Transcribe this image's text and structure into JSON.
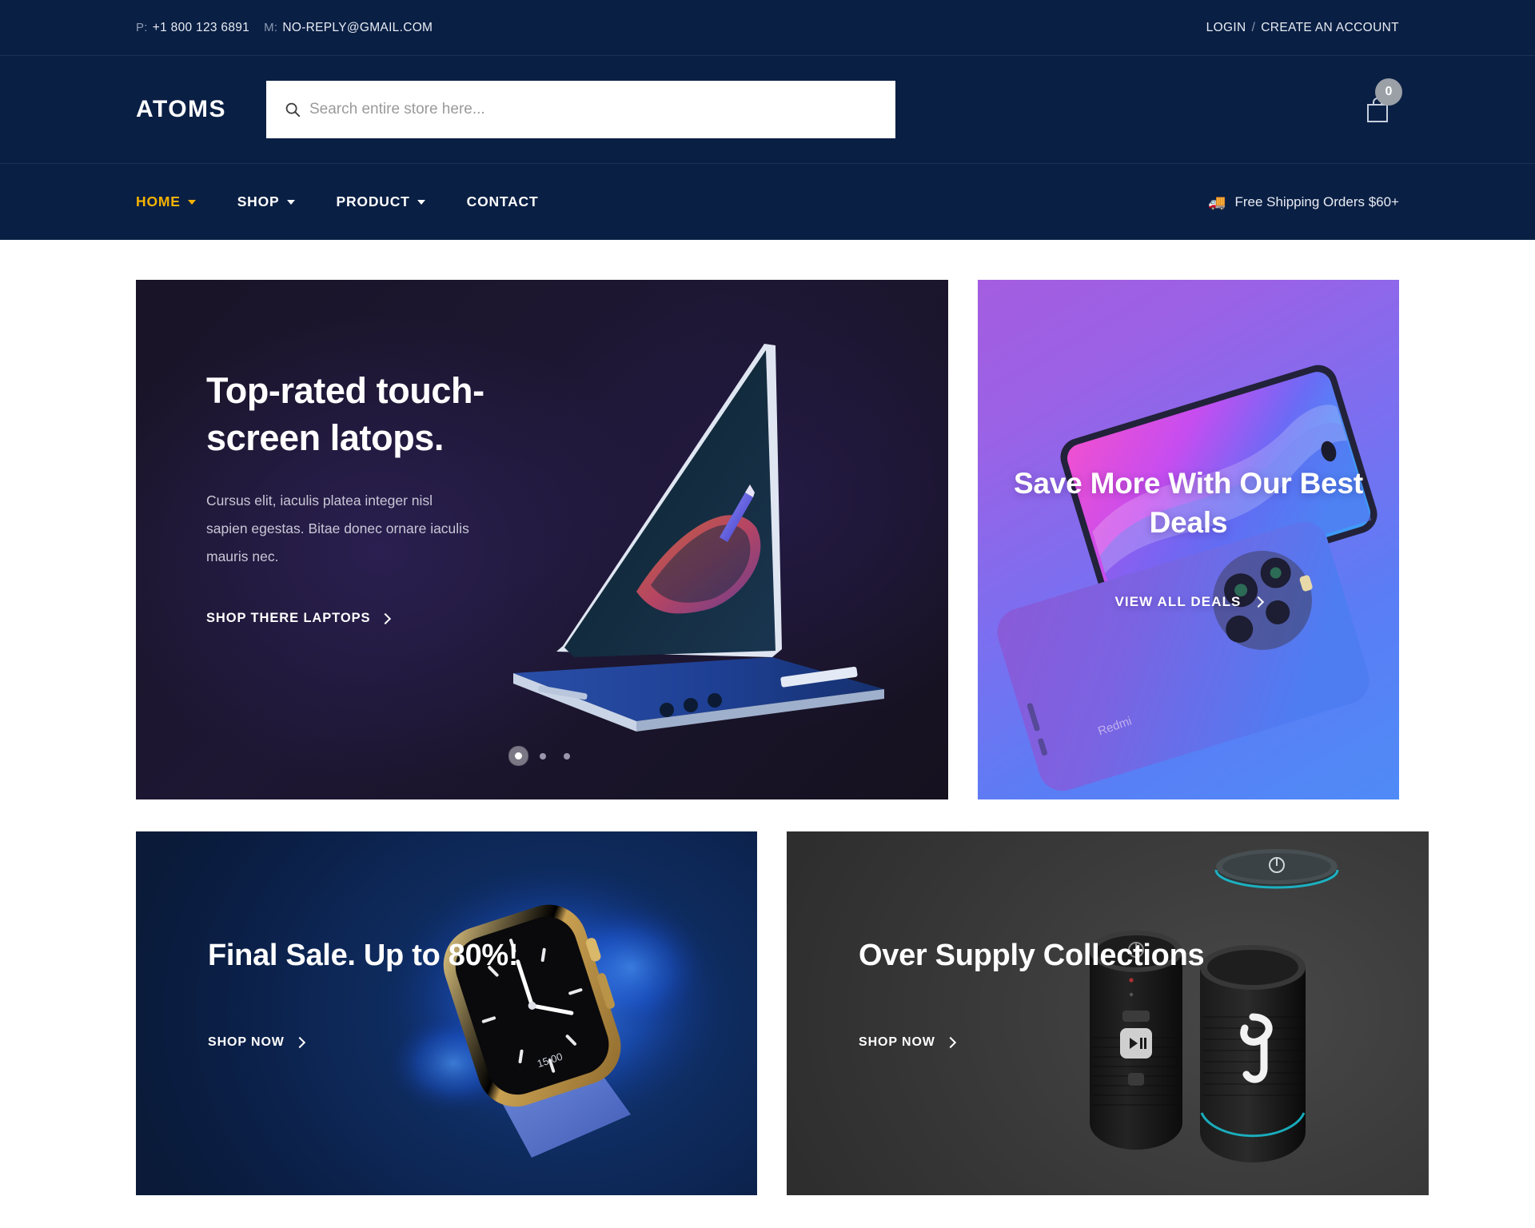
{
  "topbar": {
    "phone_label": "P:",
    "phone_value": "+1 800 123 6891",
    "mail_label": "M:",
    "mail_value": "NO-REPLY@GMAIL.COM",
    "login_label": "LOGIN",
    "separator": "/",
    "create_account_label": "CREATE AN ACCOUNT"
  },
  "masthead": {
    "logo": "ATOMS",
    "search_placeholder": "Search entire store here...",
    "search_value": "",
    "search_icon": "search-icon",
    "cart_icon": "shopping-bag-icon",
    "cart_count": "0"
  },
  "nav": {
    "items": [
      {
        "label": "HOME",
        "has_caret": true,
        "active": true
      },
      {
        "label": "SHOP",
        "has_caret": true,
        "active": false
      },
      {
        "label": "PRODUCT",
        "has_caret": true,
        "active": false
      },
      {
        "label": "CONTACT",
        "has_caret": false,
        "active": false
      }
    ],
    "shipping_icon": "delivery-truck-icon",
    "shipping_text": "Free Shipping Orders $60+"
  },
  "hero": {
    "title": "Top-rated touch-screen latops.",
    "body": "Cursus elit, iaculis platea integer nisl sapien egestas. Bitae donec ornare iaculis mauris nec.",
    "cta_label": "SHOP THERE LAPTOPS",
    "slides_total": 3,
    "active_slide": 1
  },
  "promo": {
    "title": "Save More With Our Best Deals",
    "cta_label": "VIEW ALL DEALS"
  },
  "cards": {
    "watch": {
      "title": "Final Sale. Up to 80%!",
      "cta_label": "SHOP NOW"
    },
    "speaker": {
      "title": "Over Supply Collections",
      "cta_label": "SHOP NOW"
    }
  },
  "colors": {
    "header_navy": "#0a1f44",
    "accent_yellow": "#f5b301",
    "page_bg": "#ffffff",
    "badge_grey": "#9aa0a6"
  }
}
